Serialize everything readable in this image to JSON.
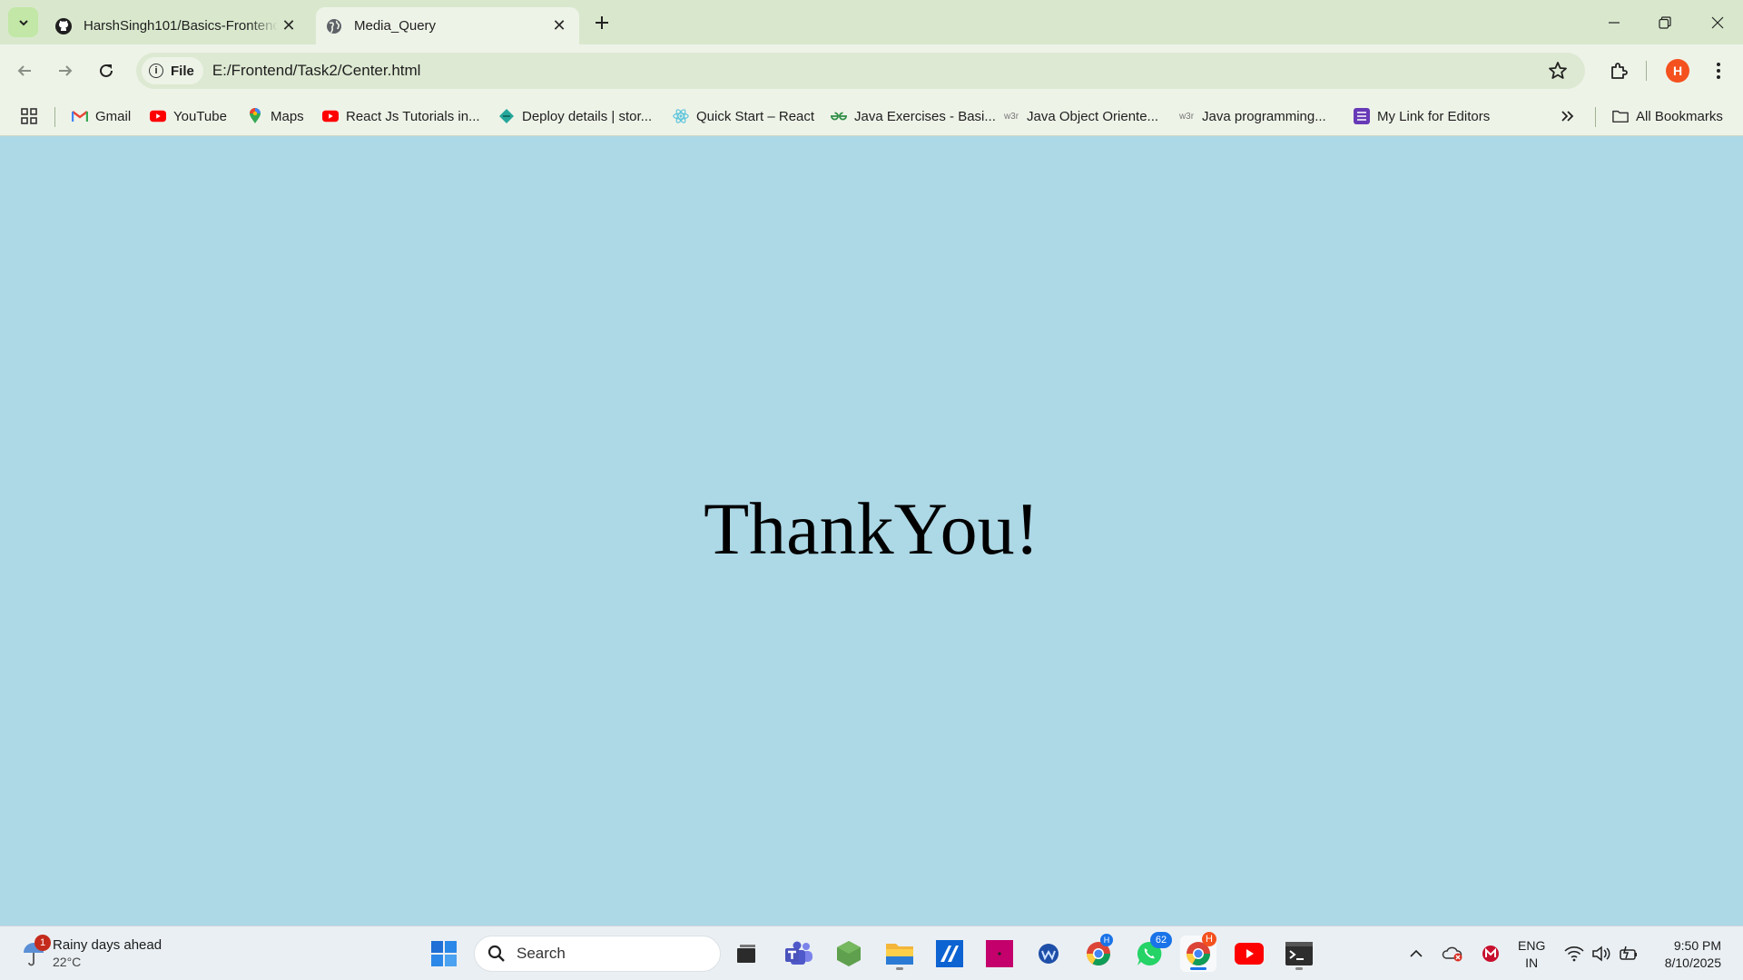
{
  "browser": {
    "tabs": [
      {
        "title": "HarshSingh101/Basics-Frontend",
        "favicon": "github-icon",
        "active": false
      },
      {
        "title": "Media_Query",
        "favicon": "globe-icon",
        "active": true
      }
    ],
    "address": {
      "chip_label": "File",
      "url": "E:/Frontend/Task2/Center.html"
    },
    "profile_initial": "H",
    "bookmarks": [
      {
        "label": "Gmail",
        "icon": "gmail-icon"
      },
      {
        "label": "YouTube",
        "icon": "youtube-icon"
      },
      {
        "label": "Maps",
        "icon": "maps-icon"
      },
      {
        "label": "React Js Tutorials in...",
        "icon": "youtube-icon"
      },
      {
        "label": "Deploy details | stor...",
        "icon": "netlify-icon"
      },
      {
        "label": "Quick Start – React",
        "icon": "react-icon"
      },
      {
        "label": "Java Exercises - Basi...",
        "icon": "gfg-icon"
      },
      {
        "label": "Java Object Oriente...",
        "icon": "w3r-icon"
      },
      {
        "label": "Java programming...",
        "icon": "w3r-icon"
      },
      {
        "label": "My Link for Editors",
        "icon": "list-icon"
      }
    ],
    "all_bookmarks_label": "All Bookmarks"
  },
  "page": {
    "heading": "ThankYou!",
    "background": "#add8e6"
  },
  "taskbar": {
    "weather": {
      "title": "Rainy days ahead",
      "temp": "22°C",
      "badge": "1"
    },
    "search_placeholder": "Search",
    "whatsapp_badge": "62",
    "chrome_profile_badge": "H",
    "language": {
      "line1": "ENG",
      "line2": "IN"
    },
    "time": "9:50 PM",
    "date": "8/10/2025"
  },
  "colors": {
    "tab_strip": "#d9e8cd",
    "toolbar": "#eef3e8",
    "accent": "#1a73e8",
    "avatar": "#f4511e"
  }
}
